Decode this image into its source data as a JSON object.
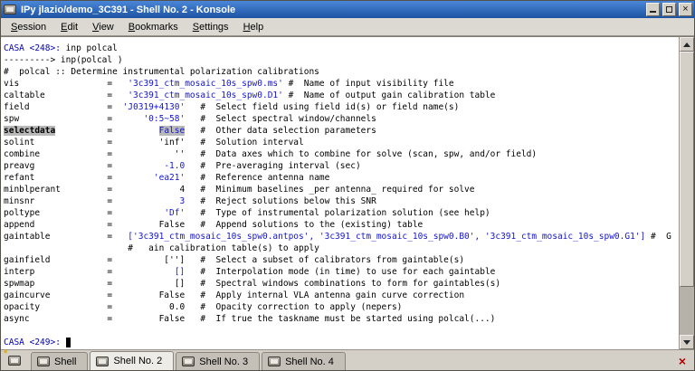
{
  "window": {
    "title": "IPy jlazio/demo_3C391 - Shell No. 2 - Konsole"
  },
  "colors": {
    "titlebar-top": "#4a86d8",
    "titlebar-bottom": "#1d53a2",
    "prompt-blue": "#0000b4",
    "value-blue": "#1414d2",
    "highlight-grey": "#b9b9b9",
    "close-red": "#b40000"
  },
  "icons": {
    "close": "×",
    "session-close": "×",
    "new-session-star": "*"
  },
  "menubar": {
    "items": [
      "Session",
      "Edit",
      "View",
      "Bookmarks",
      "Settings",
      "Help"
    ]
  },
  "terminal": {
    "lines": [
      [
        {
          "t": "CASA <248>: ",
          "c": "p"
        },
        {
          "t": "inp polcal"
        }
      ],
      [
        {
          "t": "---------> inp(polcal )"
        }
      ],
      [
        {
          "t": "#  polcal :: Determine instrumental polarization calibrations"
        }
      ],
      [
        {
          "t": "vis                 =   "
        },
        {
          "t": "'3c391_ctm_mosaic_10s_spw0.ms'",
          "c": "b"
        },
        {
          "t": " #  Name of input visibility file"
        }
      ],
      [
        {
          "t": "caltable            =   "
        },
        {
          "t": "'3c391_ctm_mosaic_10s_spw0.D1'",
          "c": "b"
        },
        {
          "t": " #  Name of output gain calibration table"
        }
      ],
      [
        {
          "t": "field               =  "
        },
        {
          "t": "'J0319+4130'",
          "c": "b"
        },
        {
          "t": "   #  Select field using field id(s) or field name(s)"
        }
      ],
      [
        {
          "t": "spw                 =      "
        },
        {
          "t": "'0:5~58'",
          "c": "b"
        },
        {
          "t": "   #  Select spectral window/channels"
        }
      ],
      [
        {
          "t": "selectdata",
          "c": "hn"
        },
        {
          "t": "          =         "
        },
        {
          "t": "False",
          "c": "hv"
        },
        {
          "t": "   #  Other data selection parameters"
        }
      ],
      [
        {
          "t": "solint              =         'inf'   #  Solution interval"
        }
      ],
      [
        {
          "t": "combine             =            ''   #  Data axes which to combine for solve (scan, spw, and/or field)"
        }
      ],
      [
        {
          "t": "preavg              =          "
        },
        {
          "t": "-1.0",
          "c": "b"
        },
        {
          "t": "   #  Pre-averaging interval (sec)"
        }
      ],
      [
        {
          "t": "refant              =        "
        },
        {
          "t": "'ea21'",
          "c": "b"
        },
        {
          "t": "   #  Reference antenna name"
        }
      ],
      [
        {
          "t": "minblperant         =             4   #  Minimum baselines _per antenna_ required for solve"
        }
      ],
      [
        {
          "t": "minsnr              =             "
        },
        {
          "t": "3",
          "c": "b"
        },
        {
          "t": "   #  Reject solutions below this SNR"
        }
      ],
      [
        {
          "t": "poltype             =          "
        },
        {
          "t": "'Df'",
          "c": "b"
        },
        {
          "t": "   #  Type of instrumental polarization solution (see help)"
        }
      ],
      [
        {
          "t": "append              =         False   #  Append solutions to the (existing) table"
        }
      ],
      [
        {
          "t": "gaintable           =   "
        },
        {
          "t": "['3c391_ctm_mosaic_10s_spw0.antpos', '3c391_ctm_mosaic_10s_spw0.B0', '3c391_ctm_mosaic_10s_spw0.G1']",
          "c": "b"
        },
        {
          "t": " #  G"
        }
      ],
      [
        {
          "t": "                        #   ain calibration table(s) to apply"
        }
      ],
      [
        {
          "t": "gainfield           =          ['']   #  Select a subset of calibrators from gaintable(s)"
        }
      ],
      [
        {
          "t": "interp              =            "
        },
        {
          "t": "[]",
          "c": "b"
        },
        {
          "t": "   #  Interpolation mode (in time) to use for each gaintable"
        }
      ],
      [
        {
          "t": "spwmap              =            []   #  Spectral windows combinations to form for gaintables(s)"
        }
      ],
      [
        {
          "t": "gaincurve           =         False   #  Apply internal VLA antenna gain curve correction"
        }
      ],
      [
        {
          "t": "opacity             =           0.0   #  Opacity correction to apply (nepers)"
        }
      ],
      [
        {
          "t": "async               =         False   #  If true the taskname must be started using polcal(...)"
        }
      ],
      [],
      [
        {
          "t": "CASA <249>: ",
          "c": "p"
        },
        {
          "t": " ",
          "c": "cur"
        }
      ]
    ]
  },
  "scrollbar": {
    "thumb_top_percent": 0,
    "thumb_height_percent": 83
  },
  "tabbar": {
    "tabs": [
      {
        "label": "Shell",
        "active": false
      },
      {
        "label": "Shell No. 2",
        "active": true
      },
      {
        "label": "Shell No. 3",
        "active": false
      },
      {
        "label": "Shell No. 4",
        "active": false
      }
    ]
  }
}
